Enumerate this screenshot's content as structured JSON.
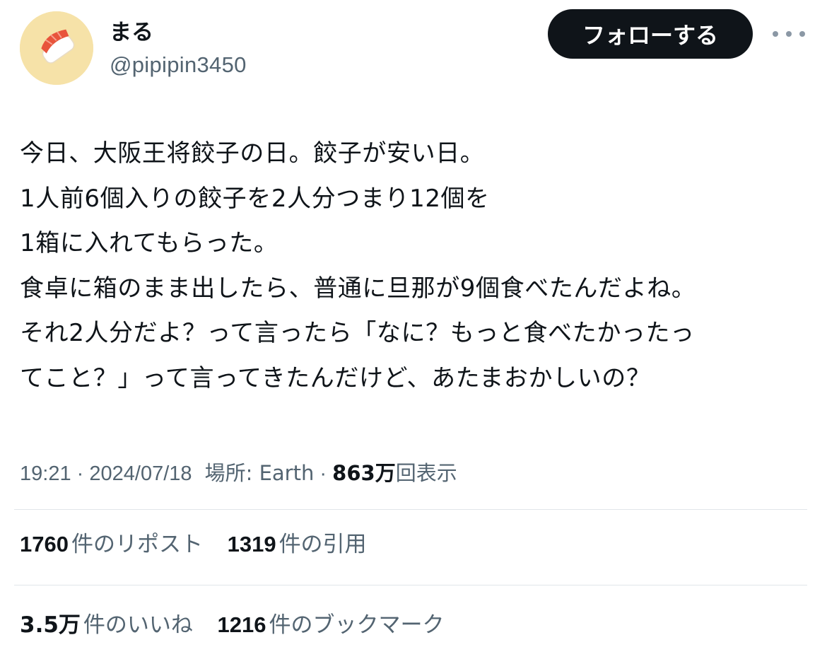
{
  "author": {
    "display_name": "まる",
    "handle": "@pipipin3450",
    "avatar_icon": "avatar-image"
  },
  "actions": {
    "follow_label": "フォローする",
    "more_icon": "more-horizontal-icon"
  },
  "tweet": {
    "lines": [
      "今日、大阪王将餃子の日。餃子が安い日。",
      "1人前6個入りの餃子を2人分つまり12個を",
      "1箱に入れてもらった。",
      "食卓に箱のまま出したら、普通に旦那が9個食べたんだよね。",
      "それ2人分だよ？って言ったら「なに？もっと食べたかったっ",
      "てこと？」って言ってきたんだけど、あたまおかしいの？"
    ]
  },
  "meta": {
    "time": "19:21",
    "separator": "·",
    "date": "2024/07/18",
    "location": "場所: Earth",
    "views_count": "863万",
    "views_label": "回表示"
  },
  "stats": {
    "reposts_count": "1760",
    "reposts_label": "件のリポスト",
    "quotes_count": "1319",
    "quotes_label": "件の引用",
    "likes_count": "3.5万",
    "likes_label": "件のいいね",
    "bookmarks_count": "1216",
    "bookmarks_label": "件のブックマーク"
  },
  "colors": {
    "text_primary": "#0f1419",
    "text_secondary": "#536471",
    "follow_bg": "#0f1419",
    "avatar_bg": "#f6e2a8",
    "divider": "#e1e6ea"
  }
}
